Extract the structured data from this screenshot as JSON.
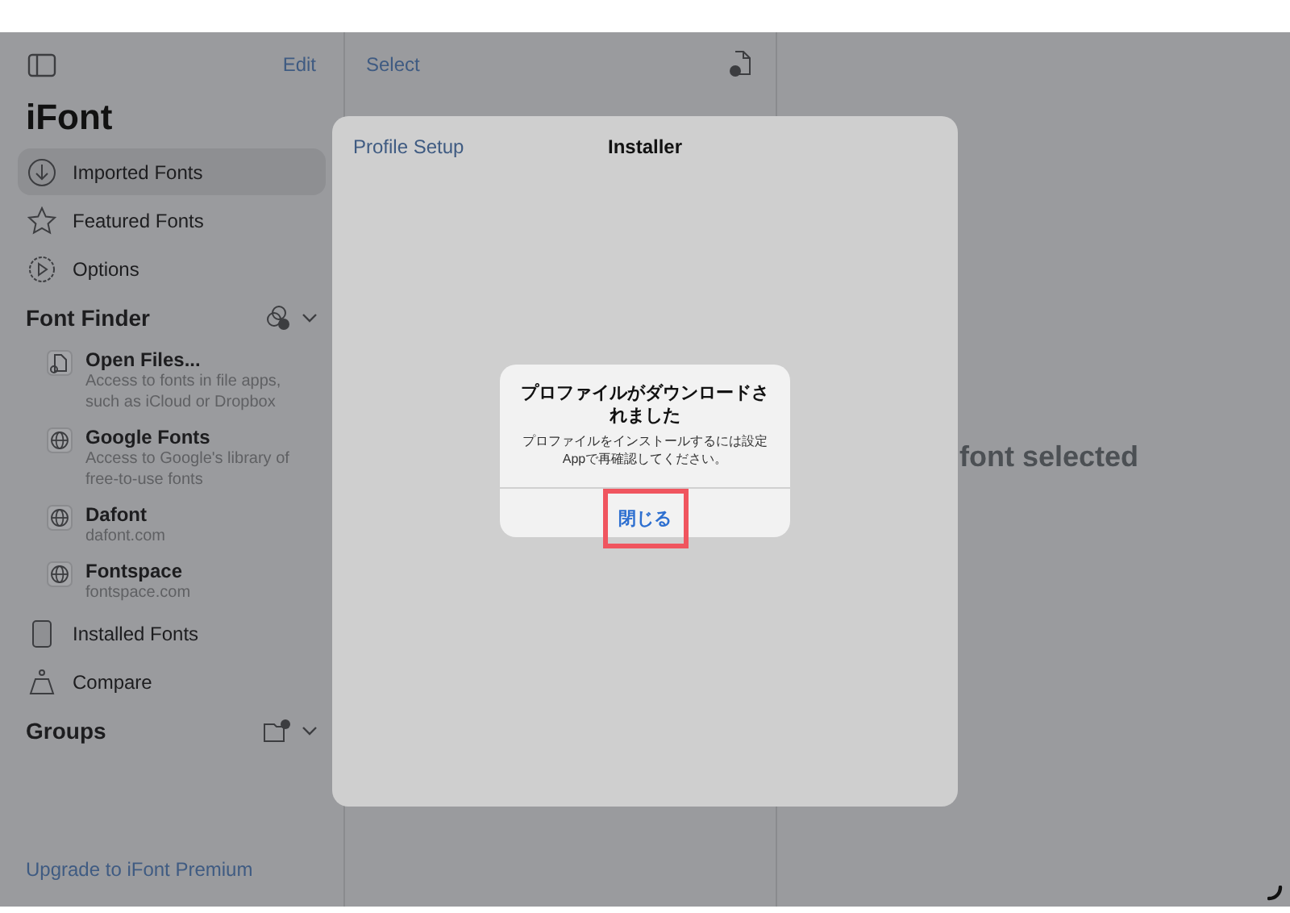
{
  "sidebar": {
    "edit_button": "Edit",
    "app_title": "iFont",
    "items": [
      {
        "label": "Imported Fonts",
        "selected": true
      },
      {
        "label": "Featured Fonts",
        "selected": false
      },
      {
        "label": "Options",
        "selected": false
      }
    ],
    "font_finder": {
      "title": "Font Finder",
      "expanded": true,
      "sources": [
        {
          "name": "Open Files...",
          "description": "Access to fonts in file apps, such as iCloud or Dropbox"
        },
        {
          "name": "Google Fonts",
          "description": "Access to Google's library of free-to-use fonts"
        },
        {
          "name": "Dafont",
          "description": "dafont.com"
        },
        {
          "name": "Fontspace",
          "description": "fontspace.com"
        }
      ]
    },
    "items_after": [
      {
        "label": "Installed Fonts",
        "selected": false
      },
      {
        "label": "Compare",
        "selected": false
      }
    ],
    "groups": {
      "title": "Groups",
      "expanded": true
    },
    "upgrade_link": "Upgrade to iFont Premium"
  },
  "list_pane": {
    "select_button": "Select"
  },
  "detail_pane": {
    "empty_message": "font selected"
  },
  "sheet": {
    "back_button": "Profile Setup",
    "title": "Installer",
    "alert": {
      "title": "プロファイルがダウンロードされました",
      "message": "プロファイルをインストールするには設定Appで再確認してください。",
      "button": "閉じる",
      "highlighted": true
    }
  }
}
